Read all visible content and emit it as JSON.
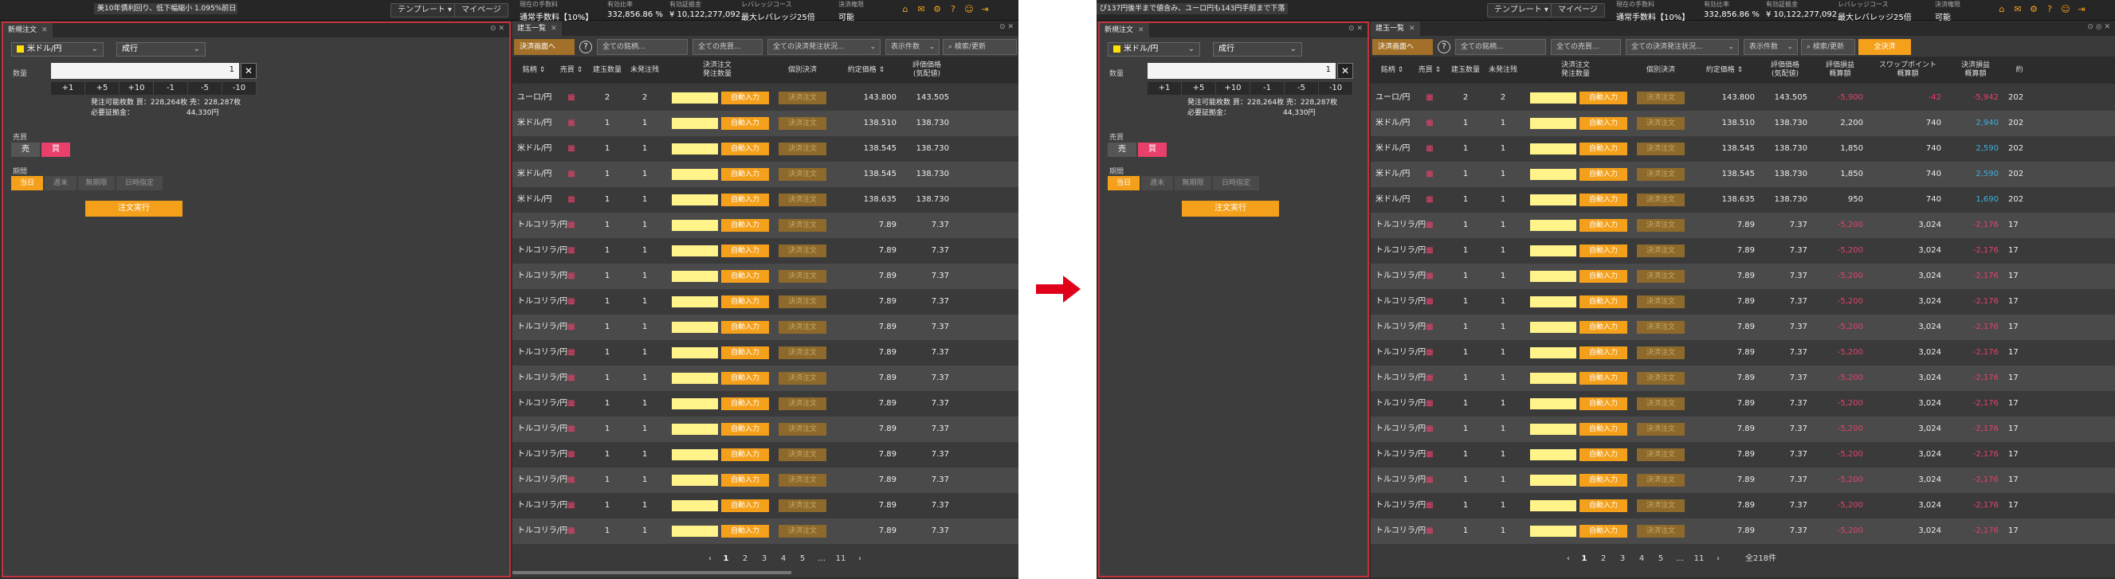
{
  "A": {
    "ticker": "美10年債利回り、低下幅縮小 1.095%前日",
    "template_btn": "テンプレート ▾",
    "mypage_btn": "マイページ",
    "info": [
      {
        "label": "現在の手数料",
        "value": "通常手数料【10%】"
      },
      {
        "label": "有効比率",
        "value": "332,856.86 %"
      },
      {
        "label": "有効証拠金",
        "value": "¥ 10,122,277,092"
      },
      {
        "label": "レバレッジコース",
        "value": "最大レバレッジ25倍"
      },
      {
        "label": "決済権限",
        "value": "可能"
      }
    ]
  },
  "B": {
    "ticker": "ぴ137円後半まで値含み、ユーロ円も143円手前まで下落",
    "template_btn": "テンプレート ▾",
    "mypage_btn": "マイページ",
    "info": [
      {
        "label": "現在の手数料",
        "value": "通常手数料【10%】"
      },
      {
        "label": "有効比率",
        "value": "332,856.86 %"
      },
      {
        "label": "有効証拠金",
        "value": "¥ 10,122,277,092"
      },
      {
        "label": "レバレッジコース",
        "value": "最大レバレッジ25倍"
      },
      {
        "label": "決済権限",
        "value": "可能"
      }
    ]
  },
  "order": {
    "tab": "新規注文",
    "pair": "米ドル/円",
    "type": "成行",
    "qty_label": "数量",
    "qty_value": "1",
    "steps": [
      "+1",
      "+5",
      "+10",
      "-1",
      "-5",
      "-10"
    ],
    "avail_line1": "発注可能枚数 買：228,264枚 売：228,287枚",
    "avail_line2": "必要証拠金：",
    "avail_value": "44,330円",
    "side_label": "売買",
    "sell": "売",
    "buy": "買",
    "period_label": "期間",
    "periods": [
      "当日",
      "週末",
      "無期限",
      "日時指定"
    ],
    "exec": "注文実行"
  },
  "positions": {
    "tab": "建玉一覧",
    "filters": {
      "settle_screen": "決済画面へ",
      "help": "?",
      "all_pairs": "全ての銘柄...",
      "all_sides": "全ての売買...",
      "all_status": "全ての決済発注状況...",
      "count": "表示件数",
      "search": "検索/更新",
      "all_settle": "全決済"
    },
    "headers": {
      "pair": "銘柄",
      "side": "売買",
      "pos_qty": "建玉数量",
      "unsettled": "未発注残",
      "settle_order": "決済注文",
      "order_qty": "発注数量",
      "individual": "個別決済",
      "price": "約定価格",
      "eval_price_1": "評価価格",
      "eval_price_2": "(気配値)",
      "eval_pl_1": "評価損益",
      "eval_pl_2": "概算額",
      "swap_1": "スワップポイント",
      "swap_2": "概算額",
      "settle_pl_1": "決済損益",
      "settle_pl_2": "概算額",
      "date_short": "約"
    },
    "auto_label": "自動入力",
    "settle_label": "決済注文",
    "side_icon": "売買",
    "rows": [
      {
        "pair": "ユーロ/円",
        "side": "買",
        "qty": "2",
        "un": "2",
        "price": "143.800",
        "eval": "143.505",
        "pl": "-5,900",
        "swap": "-42",
        "spl": "-5,942",
        "d": "202"
      },
      {
        "pair": "米ドル/円",
        "side": "買",
        "qty": "1",
        "un": "1",
        "price": "138.510",
        "eval": "138.730",
        "pl": "2,200",
        "swap": "740",
        "spl": "2,940",
        "d": "202"
      },
      {
        "pair": "米ドル/円",
        "side": "買",
        "qty": "1",
        "un": "1",
        "price": "138.545",
        "eval": "138.730",
        "pl": "1,850",
        "swap": "740",
        "spl": "2,590",
        "d": "202"
      },
      {
        "pair": "米ドル/円",
        "side": "買",
        "qty": "1",
        "un": "1",
        "price": "138.545",
        "eval": "138.730",
        "pl": "1,850",
        "swap": "740",
        "spl": "2,590",
        "d": "202"
      },
      {
        "pair": "米ドル/円",
        "side": "買",
        "qty": "1",
        "un": "1",
        "price": "138.635",
        "eval": "138.730",
        "pl": "950",
        "swap": "740",
        "spl": "1,690",
        "d": "202"
      },
      {
        "pair": "トルコリラ/円",
        "side": "買",
        "qty": "1",
        "un": "1",
        "price": "7.89",
        "eval": "7.37",
        "pl": "-5,200",
        "swap": "3,024",
        "spl": "-2,176",
        "d": "17"
      },
      {
        "pair": "トルコリラ/円",
        "side": "買",
        "qty": "1",
        "un": "1",
        "price": "7.89",
        "eval": "7.37",
        "pl": "-5,200",
        "swap": "3,024",
        "spl": "-2,176",
        "d": "17"
      },
      {
        "pair": "トルコリラ/円",
        "side": "買",
        "qty": "1",
        "un": "1",
        "price": "7.89",
        "eval": "7.37",
        "pl": "-5,200",
        "swap": "3,024",
        "spl": "-2,176",
        "d": "17"
      },
      {
        "pair": "トルコリラ/円",
        "side": "買",
        "qty": "1",
        "un": "1",
        "price": "7.89",
        "eval": "7.37",
        "pl": "-5,200",
        "swap": "3,024",
        "spl": "-2,176",
        "d": "17"
      },
      {
        "pair": "トルコリラ/円",
        "side": "買",
        "qty": "1",
        "un": "1",
        "price": "7.89",
        "eval": "7.37",
        "pl": "-5,200",
        "swap": "3,024",
        "spl": "-2,176",
        "d": "17"
      },
      {
        "pair": "トルコリラ/円",
        "side": "買",
        "qty": "1",
        "un": "1",
        "price": "7.89",
        "eval": "7.37",
        "pl": "-5,200",
        "swap": "3,024",
        "spl": "-2,176",
        "d": "17"
      },
      {
        "pair": "トルコリラ/円",
        "side": "買",
        "qty": "1",
        "un": "1",
        "price": "7.89",
        "eval": "7.37",
        "pl": "-5,200",
        "swap": "3,024",
        "spl": "-2,176",
        "d": "17"
      },
      {
        "pair": "トルコリラ/円",
        "side": "買",
        "qty": "1",
        "un": "1",
        "price": "7.89",
        "eval": "7.37",
        "pl": "-5,200",
        "swap": "3,024",
        "spl": "-2,176",
        "d": "17"
      },
      {
        "pair": "トルコリラ/円",
        "side": "買",
        "qty": "1",
        "un": "1",
        "price": "7.89",
        "eval": "7.37",
        "pl": "-5,200",
        "swap": "3,024",
        "spl": "-2,176",
        "d": "17"
      },
      {
        "pair": "トルコリラ/円",
        "side": "買",
        "qty": "1",
        "un": "1",
        "price": "7.89",
        "eval": "7.37",
        "pl": "-5,200",
        "swap": "3,024",
        "spl": "-2,176",
        "d": "17"
      },
      {
        "pair": "トルコリラ/円",
        "side": "買",
        "qty": "1",
        "un": "1",
        "price": "7.89",
        "eval": "7.37",
        "pl": "-5,200",
        "swap": "3,024",
        "spl": "-2,176",
        "d": "17"
      },
      {
        "pair": "トルコリラ/円",
        "side": "買",
        "qty": "1",
        "un": "1",
        "price": "7.89",
        "eval": "7.37",
        "pl": "-5,200",
        "swap": "3,024",
        "spl": "-2,176",
        "d": "17"
      },
      {
        "pair": "トルコリラ/円",
        "side": "買",
        "qty": "1",
        "un": "1",
        "price": "7.89",
        "eval": "7.37",
        "pl": "-5,200",
        "swap": "3,024",
        "spl": "-2,176",
        "d": "17"
      }
    ],
    "pager": [
      "1",
      "2",
      "3",
      "4",
      "5",
      "…",
      "11"
    ],
    "total": "全218件"
  },
  "colors": {
    "accent": "#f5a01a",
    "highlight": "#c0323c",
    "buy": "#e8406a",
    "arrow": "#e0001a"
  }
}
